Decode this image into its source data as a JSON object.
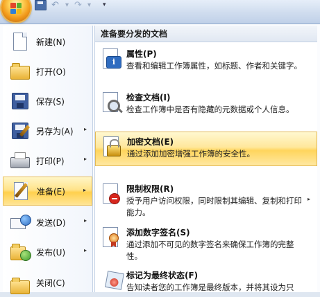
{
  "colors": {
    "accent_hover": "#ffd04d",
    "menu_background": "#ffffff",
    "header_background": "#e1e8f2"
  },
  "quick_access": {
    "save_icon": "save-icon",
    "undo_icon": "undo-icon",
    "redo_icon": "redo-icon",
    "undo_glyph": "↶",
    "redo_glyph": "↷",
    "separator_glyph": "▾",
    "more_glyph": "▾"
  },
  "left_menu": {
    "items": [
      {
        "label": "新建(N)",
        "icon": "new-document-icon"
      },
      {
        "label": "打开(O)",
        "icon": "open-folder-icon"
      },
      {
        "label": "保存(S)",
        "icon": "save-disk-icon"
      },
      {
        "label": "另存为(A)",
        "icon": "save-as-icon",
        "arrow": "▸"
      },
      {
        "label": "打印(P)",
        "icon": "printer-icon",
        "arrow": "▸"
      },
      {
        "label": "准备(E)",
        "icon": "prepare-pen-icon",
        "arrow": "▸"
      },
      {
        "label": "发送(D)",
        "icon": "send-envelope-icon",
        "arrow": "▸"
      },
      {
        "label": "发布(U)",
        "icon": "publish-globe-icon",
        "arrow": "▸"
      },
      {
        "label": "关闭(C)",
        "icon": "close-document-icon"
      }
    ]
  },
  "right_panel": {
    "header": "准备要分发的文档",
    "items": [
      {
        "title": "属性(P)",
        "desc": "查看和编辑工作簿属性，如标题、作者和关键字。",
        "icon": "properties-icon"
      },
      {
        "title": "检查文档(I)",
        "desc": "检查工作簿中是否有隐藏的元数据或个人信息。",
        "icon": "inspect-document-icon"
      },
      {
        "title": "加密文档(E)",
        "desc": "通过添加加密增强工作簿的安全性。",
        "icon": "encrypt-lock-icon"
      },
      {
        "title": "限制权限(R)",
        "desc": "授予用户访问权限，同时限制其编辑、复制和打印能力。",
        "icon": "restrict-permission-icon",
        "arrow": "▸"
      },
      {
        "title": "添加数字签名(S)",
        "desc": "通过添加不可见的数字签名来确保工作簿的完整性。",
        "icon": "digital-signature-icon"
      },
      {
        "title": "标记为最终状态(F)",
        "desc": "告知读者您的工作簿是最终版本，并将其设为只读。",
        "icon": "mark-final-icon"
      }
    ]
  }
}
